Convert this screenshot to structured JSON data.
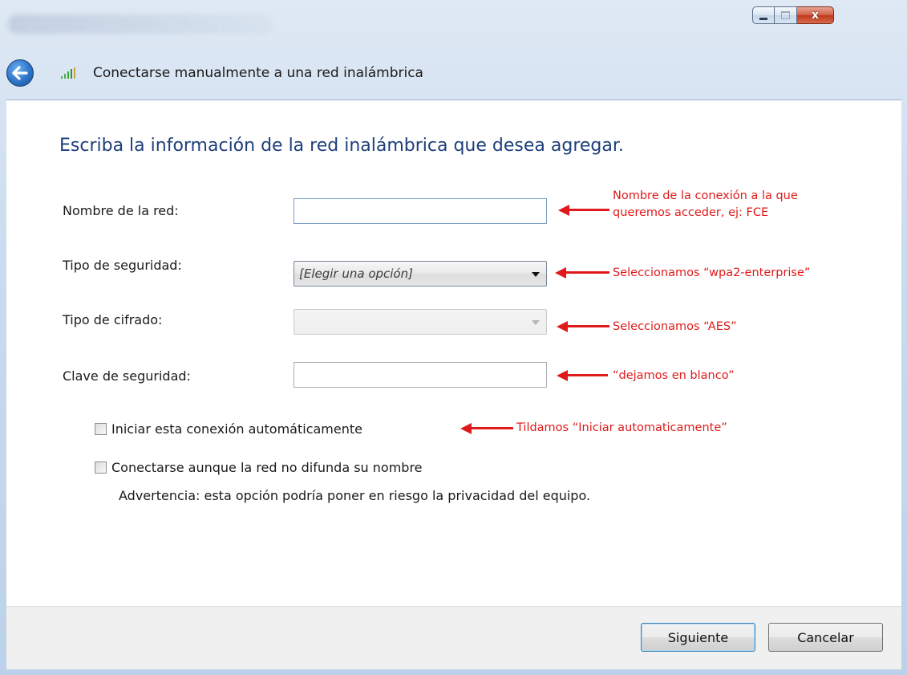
{
  "window": {
    "title": "Conectarse manualmente a una red inalámbrica",
    "caption_buttons": {
      "minimize": "minimize-icon",
      "maximize": "maximize-icon",
      "close_glyph": "x"
    }
  },
  "form": {
    "heading": "Escriba la información de la red inalámbrica que desea agregar.",
    "network_name_label": "Nombre de la red:",
    "network_name_value": "",
    "security_type_label": "Tipo de seguridad:",
    "security_type_value": "[Elegir una opción]",
    "encryption_type_label": "Tipo de cifrado:",
    "encryption_type_value": "",
    "security_key_label": "Clave de seguridad:",
    "security_key_value": "",
    "auto_start_label": "Iniciar esta conexión automáticamente",
    "auto_start_checked": false,
    "connect_hidden_label": "Conectarse aunque la red no difunda su nombre",
    "connect_hidden_checked": false,
    "warning": "Advertencia: esta opción podría poner en riesgo la privacidad del equipo."
  },
  "footer": {
    "next_label": "Siguiente",
    "cancel_label": "Cancelar"
  },
  "annotations": {
    "network_name_line1": "Nombre de la conexión a la que",
    "network_name_line2": "queremos acceder, ej: FCE",
    "security_type": "Seleccionamos “wpa2-enterprise”",
    "encryption_type": "Seleccionamos “AES”",
    "security_key": "“dejamos en blanco”",
    "auto_start": "Tildamos “Iniciar automaticamente”",
    "color": "#e01a1a"
  },
  "icons": {
    "back": "back-arrow-icon",
    "network": "wireless-signal-icon"
  }
}
